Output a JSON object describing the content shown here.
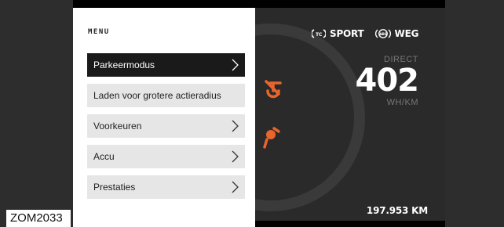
{
  "image_code": "ZOM2033",
  "menu": {
    "title": "MENU",
    "items": [
      {
        "label": "Parkeermodus",
        "chevron": true,
        "active": true
      },
      {
        "label": "Laden voor grotere actieradius",
        "chevron": false,
        "active": false
      },
      {
        "label": "Voorkeuren",
        "chevron": true,
        "active": false
      },
      {
        "label": "Accu",
        "chevron": true,
        "active": false
      },
      {
        "label": "Prestaties",
        "chevron": true,
        "active": false
      }
    ]
  },
  "dashboard": {
    "indicators": [
      {
        "icon": "traction-control-icon",
        "label": "SPORT"
      },
      {
        "icon": "abs-icon",
        "label": "WEG"
      }
    ],
    "direct_label": "DIRECT",
    "direct_value": "402",
    "direct_unit": "WH/KM",
    "odometer": "197.953 KM"
  },
  "colors": {
    "accent_orange": "#e8662c",
    "menu_active_bg": "#1a1a1a",
    "menu_item_bg": "#e6e6e6"
  }
}
